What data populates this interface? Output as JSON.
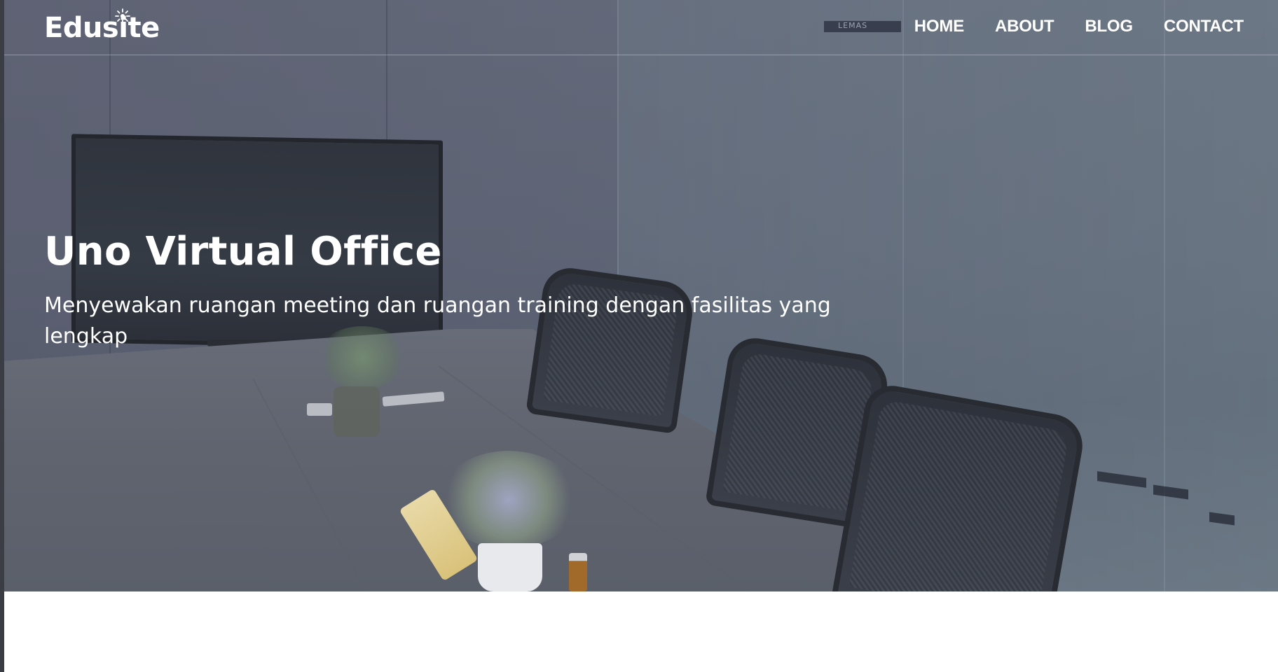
{
  "brand": {
    "logo_text": "Edusite",
    "icon": "sparkle-burst-icon"
  },
  "nav": {
    "items": [
      {
        "label": "HOME"
      },
      {
        "label": "ABOUT"
      },
      {
        "label": "BLOG"
      },
      {
        "label": "CONTACT"
      }
    ]
  },
  "hero": {
    "title": "Uno Virtual Office",
    "subtitle": "Menyewakan ruangan meeting dan ruangan training dengan fasilitas yang lengkap",
    "background_sign": "LEMAS",
    "overlay_color": "#5c6272"
  },
  "colors": {
    "nav_text": "#ffffff",
    "hero_text": "#ffffff",
    "content_bg": "#ffffff"
  }
}
